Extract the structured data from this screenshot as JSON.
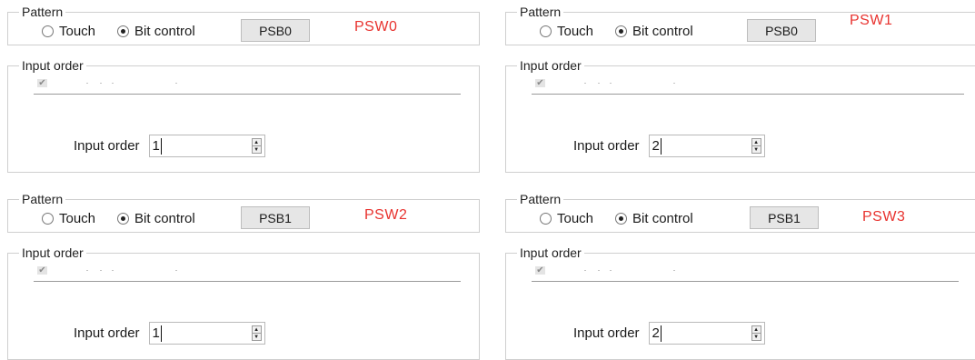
{
  "panels": [
    {
      "pattern_title": "Pattern",
      "touch_label": "Touch",
      "bit_control_label": "Bit control",
      "psb_label": "PSB0",
      "psw_label": "PSW0",
      "input_order_title": "Input order",
      "input_order_label": "Input order",
      "input_order_value": "1",
      "selected_mode": "bit-control"
    },
    {
      "pattern_title": "Pattern",
      "touch_label": "Touch",
      "bit_control_label": "Bit control",
      "psb_label": "PSB0",
      "psw_label": "PSW1",
      "input_order_title": "Input order",
      "input_order_label": "Input order",
      "input_order_value": "2",
      "selected_mode": "bit-control"
    },
    {
      "pattern_title": "Pattern",
      "touch_label": "Touch",
      "bit_control_label": "Bit control",
      "psb_label": "PSB1",
      "psw_label": "PSW2",
      "input_order_title": "Input order",
      "input_order_label": "Input order",
      "input_order_value": "1",
      "selected_mode": "bit-control"
    },
    {
      "pattern_title": "Pattern",
      "touch_label": "Touch",
      "bit_control_label": "Bit control",
      "psb_label": "PSB1",
      "psw_label": "PSW3",
      "input_order_title": "Input order",
      "input_order_label": "Input order",
      "input_order_value": "2",
      "selected_mode": "bit-control"
    }
  ],
  "colors": {
    "psw_label": "#e8332f",
    "button_bg": "#e6e6e6",
    "group_border": "#cfcfcf"
  },
  "icons": {
    "spin_up": "spin-up-arrow-icon",
    "spin_down": "spin-down-arrow-icon",
    "check": "check-icon"
  }
}
